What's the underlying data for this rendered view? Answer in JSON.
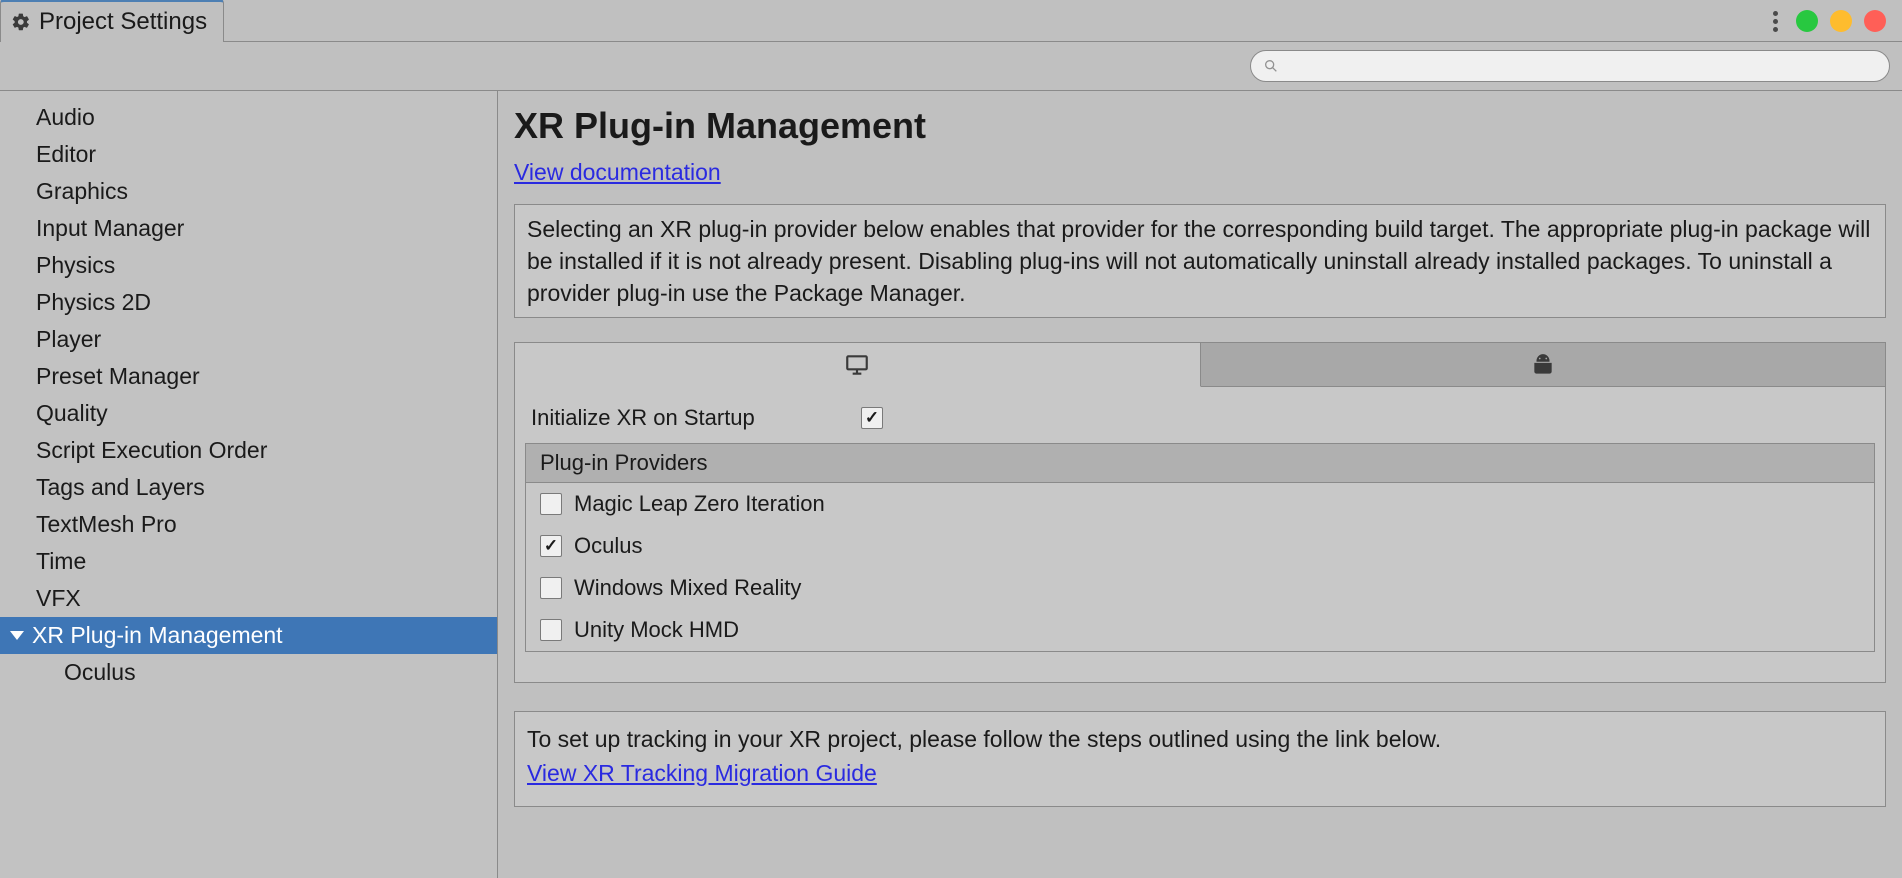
{
  "window": {
    "tab_title": "Project Settings"
  },
  "search": {
    "placeholder": ""
  },
  "sidebar": {
    "items": [
      "Audio",
      "Editor",
      "Graphics",
      "Input Manager",
      "Physics",
      "Physics 2D",
      "Player",
      "Preset Manager",
      "Quality",
      "Script Execution Order",
      "Tags and Layers",
      "TextMesh Pro",
      "Time",
      "VFX"
    ],
    "selected": "XR Plug-in Management",
    "children": [
      "Oculus"
    ]
  },
  "main": {
    "title": "XR Plug-in Management",
    "doc_link": "View documentation",
    "info_text": "Selecting an XR plug-in provider below enables that provider for the corresponding build target. The appropriate plug-in package will be installed if it is not already present. Disabling plug-ins will not automatically uninstall already installed packages. To uninstall a provider plug-in use the Package Manager.",
    "platform_tabs": {
      "desktop": "desktop",
      "android": "android"
    },
    "init_label": "Initialize XR on Startup",
    "init_checked": true,
    "providers_header": "Plug-in Providers",
    "providers": [
      {
        "label": "Magic Leap Zero Iteration",
        "checked": false
      },
      {
        "label": "Oculus",
        "checked": true
      },
      {
        "label": "Windows Mixed Reality",
        "checked": false
      },
      {
        "label": "Unity Mock HMD",
        "checked": false
      }
    ],
    "tracking_text": "To set up tracking in your XR project, please follow the steps outlined using the link below.",
    "tracking_link": "View XR Tracking Migration Guide"
  }
}
